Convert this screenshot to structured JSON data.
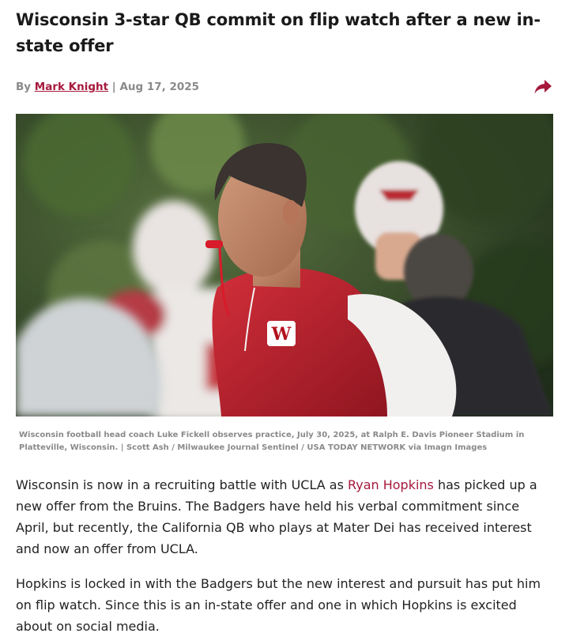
{
  "article": {
    "headline": "Wisconsin 3-star QB commit on flip watch after a new in-state offer",
    "byline": {
      "prefix": "By ",
      "author": "Mark Knight",
      "separator": " | ",
      "date": "Aug 17, 2025"
    },
    "share_icon": "share-arrow-icon",
    "image": {
      "jersey_logo": "W"
    },
    "caption": "Wisconsin football head coach Luke Fickell observes practice, July 30, 2025, at Ralph E. Davis Pioneer Stadium in Platteville, Wisconsin. | Scott Ash / Milwaukee Journal Sentinel / USA TODAY NETWORK via Imagn Images",
    "paragraphs": [
      {
        "before_link": "Wisconsin is now in a recruiting battle with UCLA as ",
        "link": "Ryan Hopkins",
        "after_link": " has picked up a new offer from the Bruins. The Badgers have held his verbal commitment since April, but recently, the California QB who plays at Mater Dei has received interest and now an offer from UCLA."
      },
      {
        "text": "Hopkins is locked in with the Badgers but the new interest and pursuit has put him on flip watch. Since this is an in-state offer and one in which Hopkins is excited about on social media."
      }
    ]
  },
  "colors": {
    "accent": "#a6193c",
    "meta_gray": "#8a8a8a",
    "body_text": "#222222"
  }
}
